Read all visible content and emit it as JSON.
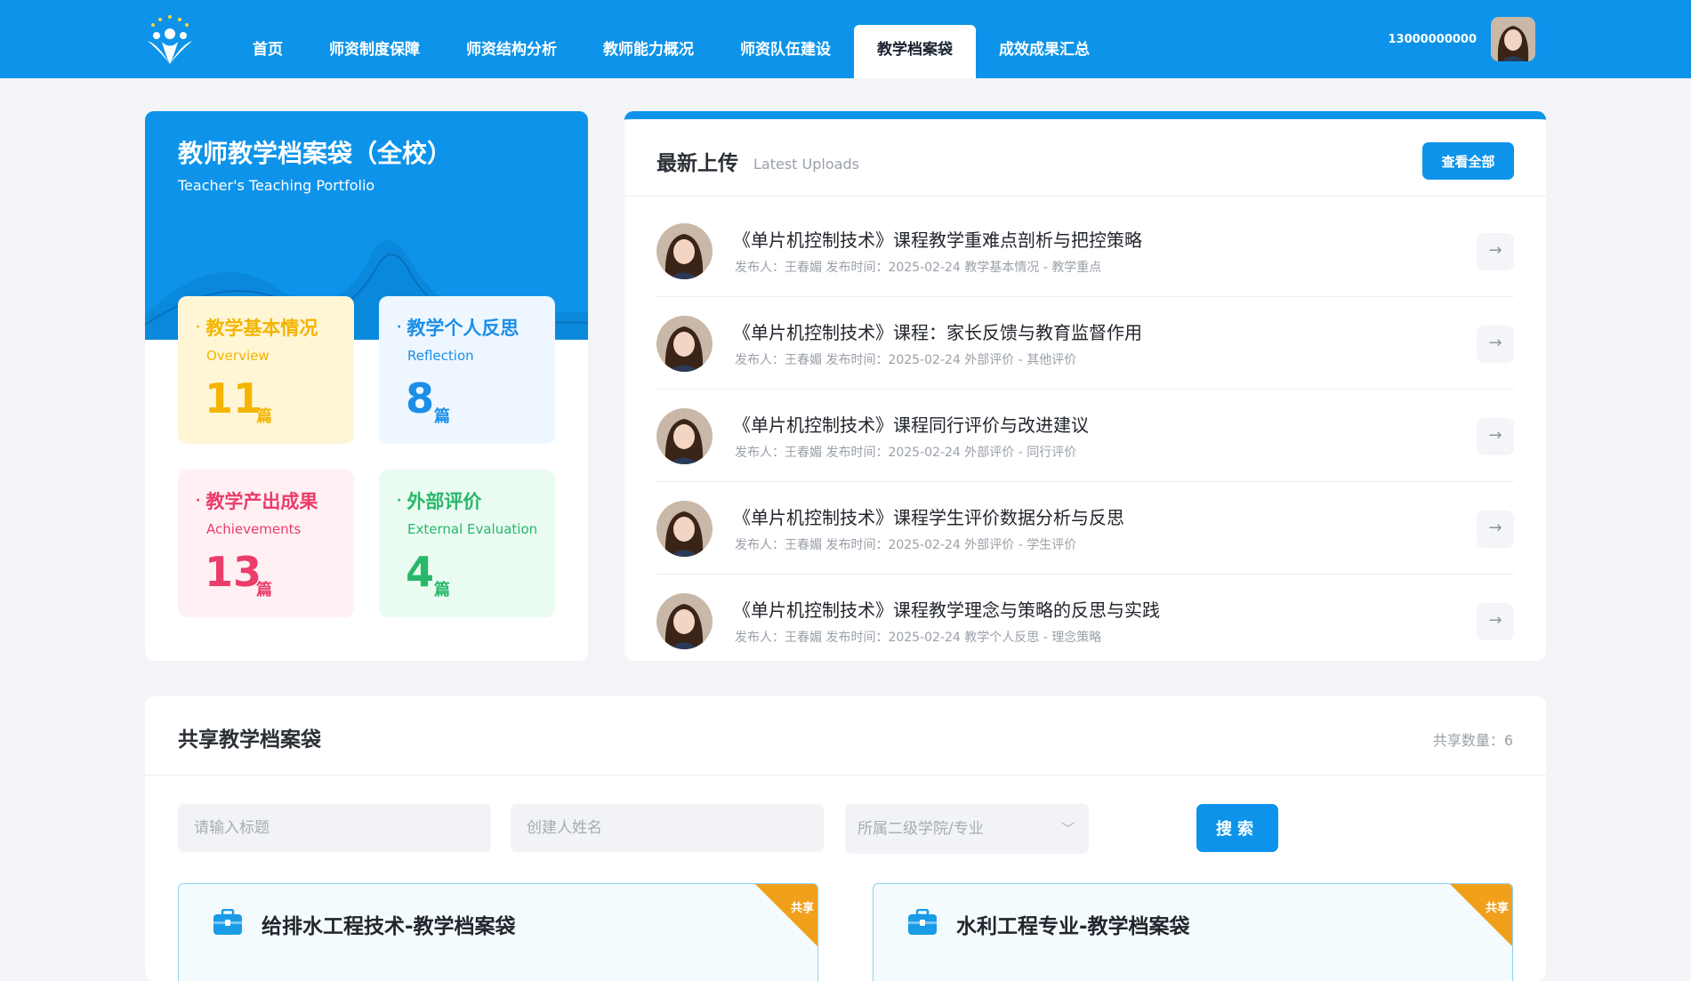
{
  "nav": {
    "items": [
      {
        "label": "首页"
      },
      {
        "label": "师资制度保障"
      },
      {
        "label": "师资结构分析"
      },
      {
        "label": "教师能力概况"
      },
      {
        "label": "师资队伍建设"
      },
      {
        "label": "教学档案袋",
        "active": true
      },
      {
        "label": "成效成果汇总"
      }
    ],
    "user_phone": "13000000000"
  },
  "portfolio": {
    "title": "教师教学档案袋（全校）",
    "subtitle": "Teacher's Teaching Portfolio",
    "stats": [
      {
        "title": "教学基本情况",
        "en": "Overview",
        "count": "11",
        "unit": "篇",
        "color": "#f4b400"
      },
      {
        "title": "教学个人反思",
        "en": "Reflection",
        "count": "8",
        "unit": "篇",
        "color": "#1b8ee8"
      },
      {
        "title": "教学产出成果",
        "en": "Achievements",
        "count": "13",
        "unit": "篇",
        "color": "#eb3c6a"
      },
      {
        "title": "外部评价",
        "en": "External Evaluation",
        "count": "4",
        "unit": "篇",
        "color": "#27b86a"
      }
    ]
  },
  "latest": {
    "title": "最新上传",
    "title_en": "Latest Uploads",
    "view_all": "查看全部",
    "items": [
      {
        "title": "《单片机控制技术》课程教学重难点剖析与把控策略",
        "meta": "发布人：王春媚 发布时间：2025-02-24 教学基本情况 - 教学重点"
      },
      {
        "title": "《单片机控制技术》课程：家长反馈与教育监督作用",
        "meta": "发布人：王春媚 发布时间：2025-02-24 外部评价 - 其他评价"
      },
      {
        "title": "《单片机控制技术》课程同行评价与改进建议",
        "meta": "发布人：王春媚 发布时间：2025-02-24 外部评价 - 同行评价"
      },
      {
        "title": "《单片机控制技术》课程学生评价数据分析与反思",
        "meta": "发布人：王春媚 发布时间：2025-02-24 外部评价 - 学生评价"
      },
      {
        "title": "《单片机控制技术》课程教学理念与策略的反思与实践",
        "meta": "发布人：王春媚 发布时间：2025-02-24 教学个人反思 - 理念策略"
      }
    ]
  },
  "shared": {
    "title": "共享教学档案袋",
    "count_text": "共享数量：6",
    "filters": {
      "title_placeholder": "请输入标题",
      "creator_placeholder": "创建人姓名",
      "college_placeholder": "所属二级学院/专业"
    },
    "search_label": "搜索",
    "ribbon_label": "共享",
    "cards": [
      {
        "name": "给排水工程技术-教学档案袋"
      },
      {
        "name": "水利工程专业-教学档案袋"
      }
    ]
  }
}
